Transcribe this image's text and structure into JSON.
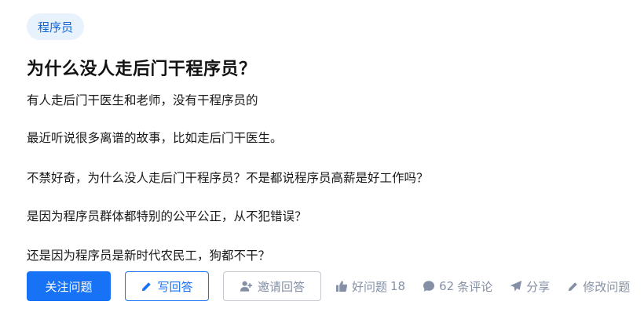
{
  "topic": {
    "tag": "程序员"
  },
  "question": {
    "title": "为什么没人走后门干程序员？",
    "body": [
      "有人走后门干医生和老师，没有干程序员的",
      "最近听说很多离谱的故事，比如走后门干医生。",
      "不禁好奇，为什么没人走后门干程序员？不是都说程序员高薪是好工作吗？",
      "是因为程序员群体都特别的公平公正，从不犯错误？",
      "还是因为程序员是新时代农民工，狗都不干？"
    ]
  },
  "actions": {
    "follow_label": "关注问题",
    "answer_label": "写回答",
    "invite_label": "邀请回答",
    "like_label": "好问题",
    "like_count": "18",
    "comment_count": "62",
    "comment_label": "条评论",
    "share_label": "分享",
    "edit_label": "修改问题"
  },
  "colors": {
    "accent": "#1772f6",
    "tag_bg": "#e8f2fd",
    "muted": "#8590a6"
  },
  "icons": [
    "pencil-icon",
    "add-user-icon",
    "thumbs-up-icon",
    "comment-icon",
    "paper-plane-icon",
    "edit-pencil-icon"
  ]
}
